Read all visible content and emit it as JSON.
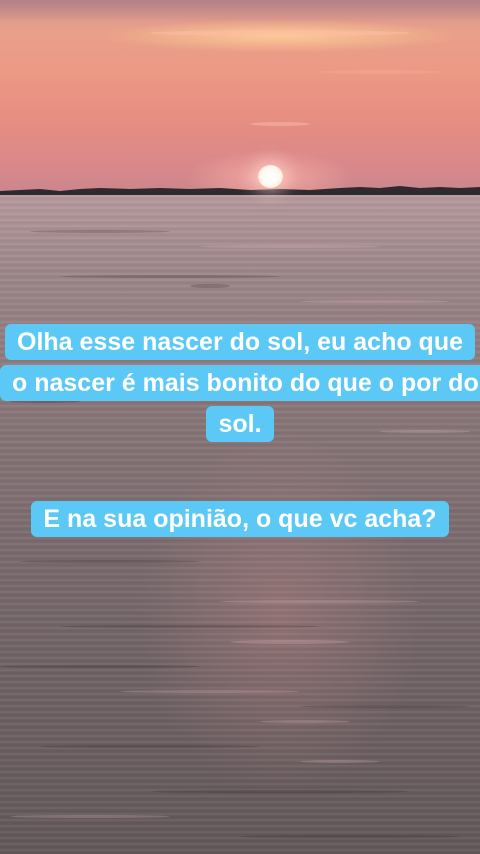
{
  "scene": {
    "description_colors": {
      "sky": "#e8978a",
      "sun": "#ffffff",
      "water": "#7c6c6f",
      "caption_background": "#5bc8f5",
      "caption_text": "#ffffff"
    }
  },
  "captions": {
    "first": "Olha esse nascer do sol, eu acho que o nascer é mais bonito do que o por do sol.",
    "second": "E na sua opinião, o que vc acha?"
  }
}
